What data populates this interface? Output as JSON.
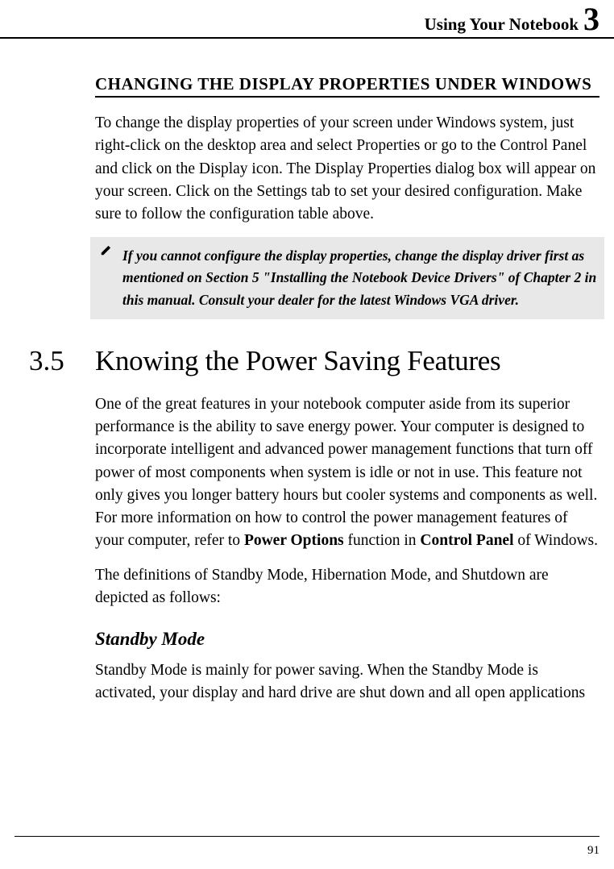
{
  "header": {
    "text": "Using Your Notebook",
    "chapter": "3"
  },
  "changing_display": {
    "heading": "CHANGING THE DISPLAY PROPERTIES UNDER WINDOWS",
    "body": "To change the display properties of your screen under Windows system, just right-click on the desktop area and select Properties or go to the Control Panel and click on the Display icon. The Display Properties dialog box will appear on your screen. Click on the Settings tab to set your desired configuration. Make sure to follow the configuration table above.",
    "note": "If you cannot configure the display properties, change the display driver first as mentioned on Section 5 \"Installing the Notebook Device Drivers\" of Chapter 2 in this manual. Consult your dealer for the latest Windows VGA driver."
  },
  "section35": {
    "num": "3.5",
    "title": "Knowing the Power Saving Features",
    "para1_pre": "One of the great features in your notebook computer aside from its superior performance is the ability to save energy power. Your computer is designed to incorporate intelligent and advanced power management functions that turn off power of most components when system is idle or not in use. This feature not only gives you longer battery hours but cooler systems and components as well. For more information on how to control the power management features of your computer, refer to ",
    "para1_bold1": "Power Options",
    "para1_mid": " function in ",
    "para1_bold2": "Control Panel",
    "para1_post": " of Windows.",
    "para2": "The definitions of Standby Mode, Hibernation Mode, and Shutdown are depicted as follows:",
    "standby_heading": "Standby Mode",
    "standby_body": "Standby Mode is mainly for power saving. When the Standby Mode is activated, your display and hard drive are shut down and all open applications"
  },
  "page_number": "91"
}
